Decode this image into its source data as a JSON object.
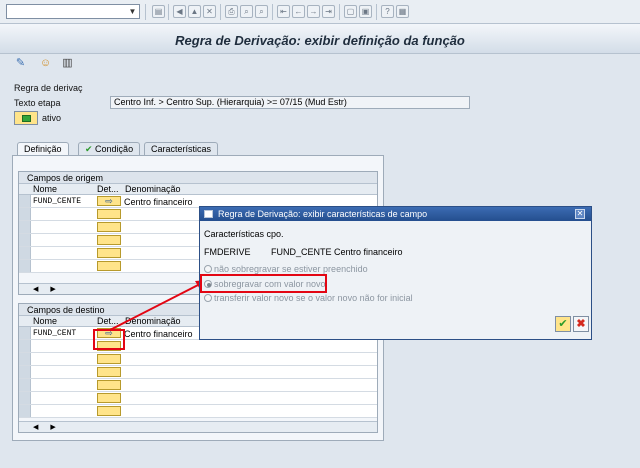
{
  "toolbar": {
    "icons": [
      "dropdown-chevron-icon",
      "save-icon",
      "back-icon",
      "exit-icon",
      "cancel-icon",
      "print-icon",
      "find-icon",
      "find-next-icon",
      "first-page-icon",
      "prev-page-icon",
      "next-page-icon",
      "last-page-icon",
      "new-session-icon",
      "shortcut-icon",
      "help-icon",
      "customize-icon"
    ]
  },
  "title": "Regra de Derivação: exibir definição da função",
  "app_toolbar": {
    "icons": [
      "display-change-icon",
      "person-icon",
      "table-icon"
    ]
  },
  "header": {
    "rule_label": "Regra de derivaç",
    "step_label": "Texto etapa",
    "step_value": "Centro Inf. > Centro Sup. (Hierarquia) >= 07/15 (Mud Estr)",
    "active_label": "ativo"
  },
  "tabs": [
    {
      "label": "Definição",
      "active": true
    },
    {
      "label": "Condição",
      "active": false,
      "icon": "checkmark-icon"
    },
    {
      "label": "Características",
      "active": false
    }
  ],
  "origin": {
    "title": "Campos de origem",
    "columns": [
      "Nome",
      "Det...",
      "Denominação"
    ],
    "rows": [
      {
        "name": "FUND_CENTE",
        "desc": "Centro financeiro"
      }
    ],
    "empty_rows": 5
  },
  "dest": {
    "title": "Campos de destino",
    "columns": [
      "Nome",
      "Det...",
      "Denominação"
    ],
    "rows": [
      {
        "name": "FUND_CENT",
        "desc": "Centro financeiro"
      }
    ],
    "empty_rows": 6
  },
  "popup": {
    "title": "Regra de Derivação: exibir características de campo",
    "section": "Características cpo.",
    "field_type": "FMDERIVE",
    "field_name": "FUND_CENTE",
    "field_desc": "Centro financeiro",
    "options": [
      {
        "label": "não sobregravar se estiver preenchido",
        "selected": false
      },
      {
        "label": "sobregravar com valor novo",
        "selected": true
      },
      {
        "label": "transferir valor novo se o valor novo não for inicial",
        "selected": false
      }
    ]
  },
  "colors": {
    "highlight": "#e30613",
    "title_bar": "#2c5496",
    "button_yellow": "#ffe48a"
  }
}
